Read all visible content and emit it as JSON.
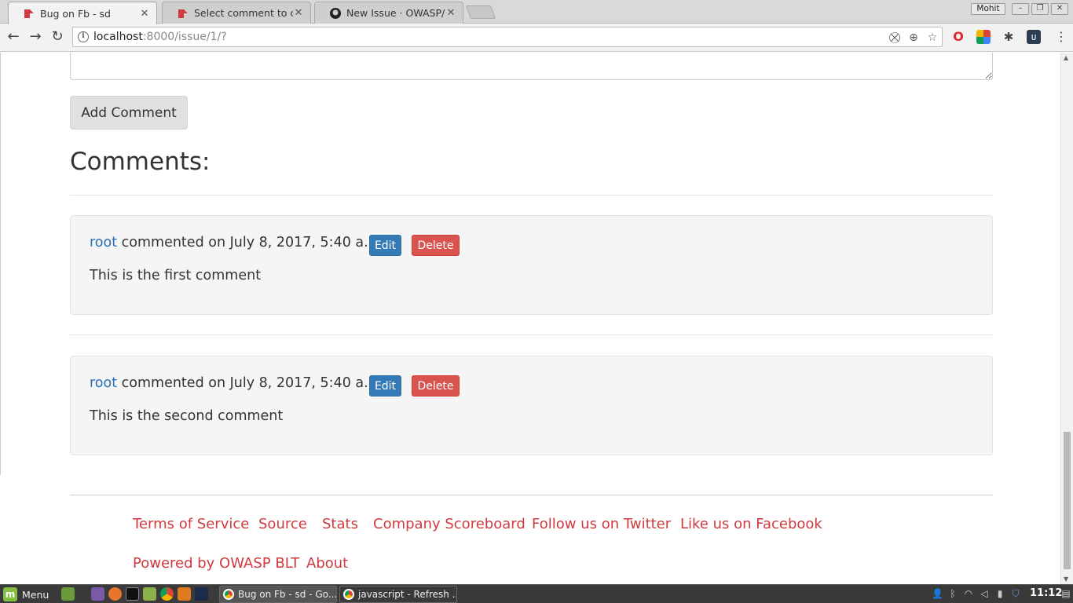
{
  "browser": {
    "tabs": [
      {
        "title": "Bug on Fb - sd",
        "favicon": "bugheist-icon",
        "active": true
      },
      {
        "title": "Select comment to char",
        "favicon": "bugheist-icon",
        "active": false
      },
      {
        "title": "New Issue · OWASP/BLT",
        "favicon": "github-icon",
        "active": false
      }
    ],
    "profile_name": "Mohit",
    "url_host": "localhost",
    "url_rest": ":8000/issue/1/?"
  },
  "page": {
    "add_comment_label": "Add Comment",
    "comments_heading": "Comments:",
    "edit_label": "Edit",
    "delete_label": "Delete",
    "comments": [
      {
        "author": "root",
        "meta": " commented on July 8, 2017, 5:40 a.m.",
        "body": "This is the first comment"
      },
      {
        "author": "root",
        "meta": " commented on July 8, 2017, 5:40 a.m.",
        "body": "This is the second comment"
      }
    ],
    "footer_links": [
      "Terms of Service",
      "Source",
      "Stats",
      "Company Scoreboard",
      "Follow us on Twitter",
      "Like us on Facebook",
      "Powered by OWASP BLT",
      "About"
    ]
  },
  "taskbar": {
    "menu_label": "Menu",
    "windows": [
      {
        "title": "Bug on Fb - sd - Go...",
        "active": true
      },
      {
        "title": "javascript - Refresh ...",
        "active": false
      }
    ],
    "clock": "11:12"
  },
  "colors": {
    "link_red": "#d0393e",
    "link_blue": "#2a6fb0",
    "edit_blue": "#337ab7",
    "delete_red": "#d9534f"
  }
}
